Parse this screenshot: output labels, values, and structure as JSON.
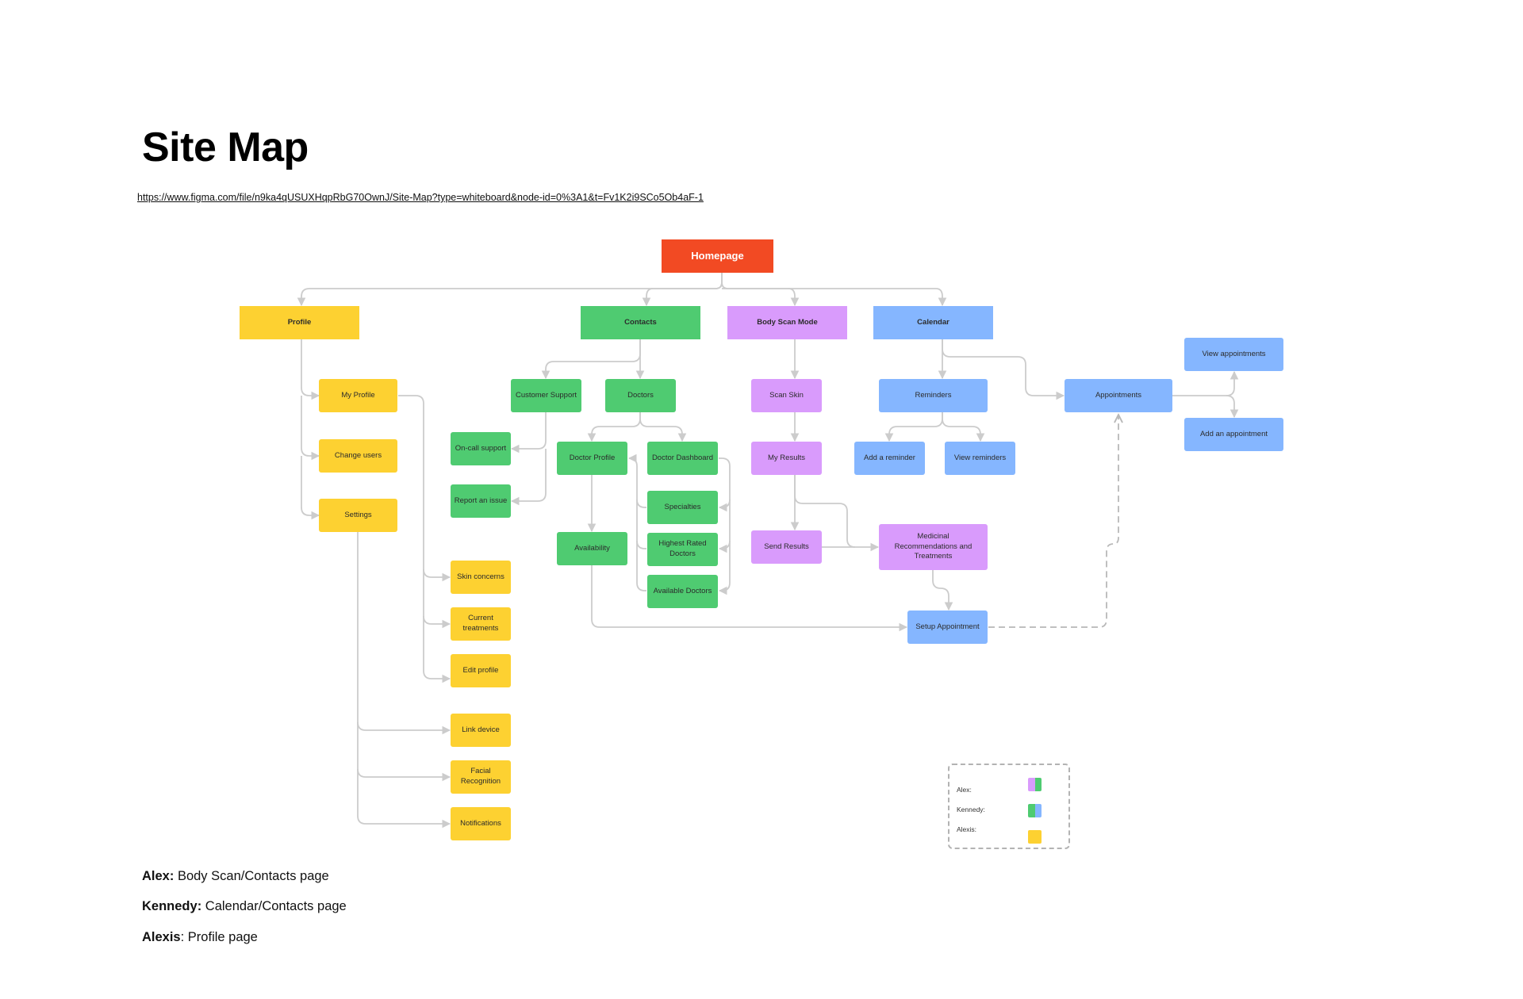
{
  "page": {
    "title": "Site Map",
    "url": "https://www.figma.com/file/n9ka4qUSUXHqpRbG70OwnJ/Site-Map?type=whiteboard&node-id=0%3A1&t=Fv1K2i9SCo5Ob4aF-1"
  },
  "colors": {
    "profile": "#fdd131",
    "contacts": "#4fcb71",
    "body_scan": "#d99bfc",
    "calendar": "#85b6ff",
    "homepage": "#f24a23",
    "connector": "#cccccc"
  },
  "nodes": {
    "homepage": "Homepage",
    "profile": "Profile",
    "contacts": "Contacts",
    "body_scan_mode": "Body Scan Mode",
    "calendar": "Calendar",
    "my_profile": "My Profile",
    "change_users": "Change users",
    "settings": "Settings",
    "skin_concerns": "Skin concerns",
    "current_treatments": "Current treatments",
    "edit_profile": "Edit profile",
    "link_device": "Link device",
    "facial_recognition": "Facial Recognition",
    "notifications": "Notifications",
    "customer_support": "Customer Support",
    "on_call_support": "On-call support",
    "report_an_issue": "Report an issue",
    "doctors": "Doctors",
    "doctor_profile": "Doctor Profile",
    "doctor_dashboard": "Doctor Dashboard",
    "specialties": "Specialties",
    "highest_rated_doctors": "Highest Rated Doctors",
    "available_doctors": "Available Doctors",
    "availability": "Availability",
    "scan_skin": "Scan Skin",
    "my_results": "My Results",
    "send_results": "Send Results",
    "medicinal_recommendations": "Medicinal Recommendations and Treatments",
    "setup_appointment": "Setup Appointment",
    "reminders": "Reminders",
    "add_a_reminder": "Add a reminder",
    "view_reminders": "View reminders",
    "appointments": "Appointments",
    "view_appointments": "View appointments",
    "add_an_appointment": "Add an appointment"
  },
  "legend": {
    "items": [
      {
        "label": "Alex:",
        "colors": [
          "#d99bfc",
          "#4fcb71"
        ]
      },
      {
        "label": "Kennedy:",
        "colors": [
          "#4fcb71",
          "#85b6ff"
        ]
      },
      {
        "label": "Alexis:",
        "colors": [
          "#fdd131"
        ]
      }
    ]
  },
  "notes": [
    {
      "name": "Alex",
      "sep": ":",
      "text": " Body Scan/Contacts page"
    },
    {
      "name": "Kennedy",
      "sep": ":",
      "text": " Calendar/Contacts page"
    },
    {
      "name": "Alexis",
      "sep": ":",
      "text": " Profile page"
    }
  ]
}
